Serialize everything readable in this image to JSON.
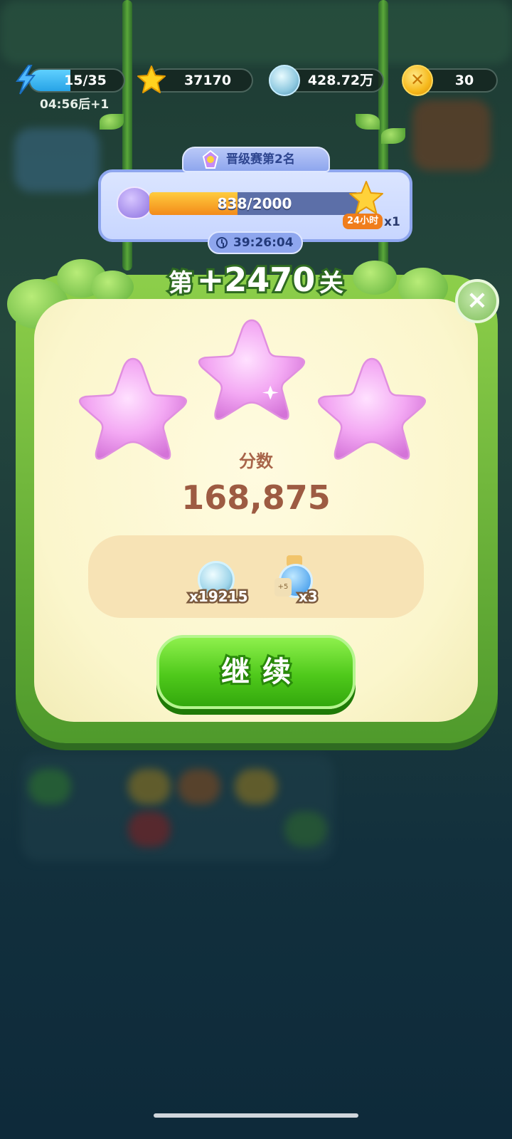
{
  "hud": {
    "energy": {
      "value": "15/35",
      "fraction": 0.43,
      "regen": "04:56后+1"
    },
    "stars": {
      "value": "37170"
    },
    "silver_coins": {
      "value": "428.72万"
    },
    "gold_coins": {
      "value": "30"
    }
  },
  "tournament": {
    "title": "晋级赛第2名",
    "progress_text": "838/2000",
    "progress_fraction": 0.419,
    "reward_badge": "24小时",
    "reward_multiplier": "x1",
    "timer": "39:26:04"
  },
  "result": {
    "level_prefix": "第",
    "level_number": "+2470",
    "level_suffix": "关",
    "stars_earned": 3,
    "score_label": "分数",
    "score_value": "168,875",
    "rewards": [
      {
        "icon": "silver-coin-icon",
        "amount": "x19215"
      },
      {
        "icon": "energy-potion-icon",
        "amount": "x3"
      }
    ],
    "continue_label": "继续",
    "close_icon": "×"
  },
  "colors": {
    "frame_green": "#5fb03a",
    "card_cream": "#fbf6cc",
    "star_pink": "#f2a8f2",
    "button_green": "#4fc91b",
    "tournament_blue": "#8ea6ee"
  }
}
